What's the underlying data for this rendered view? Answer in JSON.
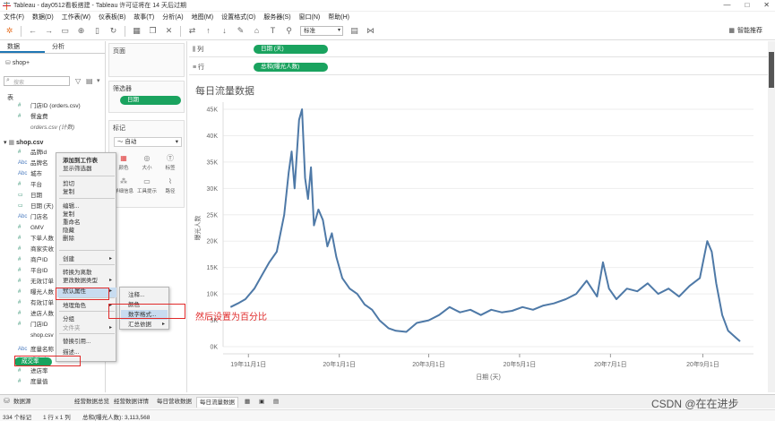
{
  "window": {
    "title": "Tableau - day0512看板搭建 - Tableau 许可证将在 14 天后过期",
    "controls": [
      "—",
      "□",
      "✕"
    ]
  },
  "menu": [
    "文件(F)",
    "数据(D)",
    "工作表(W)",
    "仪表板(B)",
    "故事(T)",
    "分析(A)",
    "地图(M)",
    "设置格式(O)",
    "服务器(S)",
    "窗口(N)",
    "帮助(H)"
  ],
  "toolbar": {
    "fit_select": "标准",
    "show_me": "智能推荐"
  },
  "left_pane": {
    "tabs": [
      "数据",
      "分析"
    ],
    "source": "shop+",
    "search_placeholder": "搜索",
    "section_table": "表",
    "fields_top": [
      {
        "type": "#",
        "name": "门店ID (orders.csv)",
        "italic": false
      },
      {
        "type": "#",
        "name": "餐盒费",
        "italic": false
      },
      {
        "type": "",
        "name": "orders.csv (计数)",
        "italic": true
      }
    ],
    "shop_table": "shop.csv",
    "shop_fields": [
      {
        "type": "#",
        "name": "品牌id"
      },
      {
        "type": "Abc",
        "name": "品牌名"
      },
      {
        "type": "Abc",
        "name": "城市"
      },
      {
        "type": "#",
        "name": "平台"
      },
      {
        "type": "▭",
        "name": "日期"
      },
      {
        "type": "▭",
        "name": "日期 (天)"
      },
      {
        "type": "Abc",
        "name": "门店名"
      },
      {
        "type": "#",
        "name": "GMV"
      },
      {
        "type": "#",
        "name": "下单人数"
      },
      {
        "type": "#",
        "name": "商家实收"
      },
      {
        "type": "#",
        "name": "商户ID"
      },
      {
        "type": "#",
        "name": "平台ID"
      },
      {
        "type": "#",
        "name": "无效订单"
      },
      {
        "type": "#",
        "name": "曝光人数"
      },
      {
        "type": "#",
        "name": "有效订单"
      },
      {
        "type": "#",
        "name": "进店人数"
      },
      {
        "type": "#",
        "name": "门店ID"
      },
      {
        "type": "",
        "name": "shop.csv"
      }
    ],
    "bottom_fields": [
      {
        "type": "Abc",
        "name": "度量名称"
      },
      {
        "type": "#",
        "name": "成交率"
      },
      {
        "type": "#",
        "name": "进店率"
      },
      {
        "type": "#",
        "name": "度量值"
      }
    ]
  },
  "cards": {
    "pages": "页面",
    "filters": "筛选器",
    "filter_pill": "日期",
    "marks": "标记",
    "mark_type": "自动",
    "mark_buttons": [
      "颜色",
      "大小",
      "标签",
      "详细信息",
      "工具提示",
      "路径"
    ]
  },
  "shelves": {
    "columns_label": "列",
    "columns_pill": "日期 (天)",
    "rows_label": "行",
    "rows_pill": "总和(曝光人数)"
  },
  "context_menu": {
    "items": [
      "添加到工作表",
      "显示筛选器",
      "剪切",
      "复制",
      "编辑...",
      "复制",
      "重命名",
      "隐藏",
      "删除",
      "创建",
      "转换为离散",
      "更改数据类型",
      "默认属性",
      "地理角色",
      "分组",
      "文件夹",
      "替换引用...",
      "描述..."
    ],
    "submenu": [
      "注释...",
      "颜色",
      "数字格式...",
      "汇总依据"
    ]
  },
  "annotation": "然后设置为百分比",
  "chart_data": {
    "type": "line",
    "title": "每日流量数据",
    "xlabel": "日期 (天)",
    "ylabel": "曝光人数",
    "x_ticks": [
      "19年11月1日",
      "20年1月1日",
      "20年3月1日",
      "20年5月1日",
      "20年7月1日",
      "20年9月1日"
    ],
    "y_ticks": [
      "0K",
      "5K",
      "10K",
      "15K",
      "20K",
      "25K",
      "30K",
      "35K",
      "40K",
      "45K"
    ],
    "ylim": [
      0,
      45000
    ],
    "series": [
      {
        "color": "#4e79a7",
        "points": [
          [
            "2019-10-20",
            7500
          ],
          [
            "2019-10-25",
            8200
          ],
          [
            "2019-10-30",
            9000
          ],
          [
            "2019-11-05",
            11000
          ],
          [
            "2019-11-10",
            13500
          ],
          [
            "2019-11-15",
            16000
          ],
          [
            "2019-11-20",
            18000
          ],
          [
            "2019-11-25",
            25000
          ],
          [
            "2019-11-28",
            33000
          ],
          [
            "2019-11-30",
            37000
          ],
          [
            "2019-12-02",
            30000
          ],
          [
            "2019-12-05",
            43000
          ],
          [
            "2019-12-07",
            45000
          ],
          [
            "2019-12-09",
            32000
          ],
          [
            "2019-12-11",
            28000
          ],
          [
            "2019-12-13",
            34000
          ],
          [
            "2019-12-15",
            23000
          ],
          [
            "2019-12-18",
            26000
          ],
          [
            "2019-12-21",
            24000
          ],
          [
            "2019-12-24",
            19000
          ],
          [
            "2019-12-27",
            21500
          ],
          [
            "2019-12-30",
            17000
          ],
          [
            "2020-01-03",
            13000
          ],
          [
            "2020-01-08",
            11000
          ],
          [
            "2020-01-13",
            10000
          ],
          [
            "2020-01-18",
            8000
          ],
          [
            "2020-01-23",
            7000
          ],
          [
            "2020-01-28",
            5000
          ],
          [
            "2020-02-03",
            3500
          ],
          [
            "2020-02-08",
            3000
          ],
          [
            "2020-02-15",
            2800
          ],
          [
            "2020-02-22",
            4500
          ],
          [
            "2020-03-01",
            5000
          ],
          [
            "2020-03-08",
            6000
          ],
          [
            "2020-03-15",
            7500
          ],
          [
            "2020-03-22",
            6500
          ],
          [
            "2020-03-29",
            7000
          ],
          [
            "2020-04-05",
            6000
          ],
          [
            "2020-04-12",
            7000
          ],
          [
            "2020-04-19",
            6500
          ],
          [
            "2020-04-26",
            6800
          ],
          [
            "2020-05-03",
            7500
          ],
          [
            "2020-05-10",
            7000
          ],
          [
            "2020-05-17",
            7800
          ],
          [
            "2020-05-24",
            8200
          ],
          [
            "2020-06-01",
            9000
          ],
          [
            "2020-06-08",
            10000
          ],
          [
            "2020-06-15",
            12500
          ],
          [
            "2020-06-22",
            9500
          ],
          [
            "2020-06-26",
            16000
          ],
          [
            "2020-06-30",
            11000
          ],
          [
            "2020-07-05",
            9000
          ],
          [
            "2020-07-12",
            11000
          ],
          [
            "2020-07-19",
            10500
          ],
          [
            "2020-07-26",
            12000
          ],
          [
            "2020-08-02",
            10000
          ],
          [
            "2020-08-09",
            11000
          ],
          [
            "2020-08-16",
            9500
          ],
          [
            "2020-08-23",
            11500
          ],
          [
            "2020-08-30",
            13000
          ],
          [
            "2020-09-04",
            20000
          ],
          [
            "2020-09-07",
            18000
          ],
          [
            "2020-09-10",
            12000
          ],
          [
            "2020-09-14",
            6000
          ],
          [
            "2020-09-18",
            3000
          ],
          [
            "2020-09-22",
            2000
          ],
          [
            "2020-09-26",
            1000
          ]
        ]
      }
    ]
  },
  "bottom_tabs": [
    "数据源",
    "经营数据总览",
    "经营数据详情",
    "每日营收数据",
    "每日流量数据"
  ],
  "status": {
    "marks": "334 个标记",
    "rows": "1 行 x 1 列",
    "sum": "总和(曝光人数): 3,113,568"
  },
  "watermark": "CSDN @在在进步"
}
